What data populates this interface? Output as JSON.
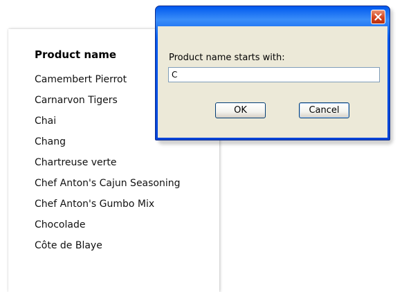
{
  "report": {
    "column_header": "Product name",
    "rows": [
      "Camembert Pierrot",
      "Carnarvon Tigers",
      "Chai",
      "Chang",
      "Chartreuse verte",
      "Chef Anton's Cajun Seasoning",
      "Chef Anton's Gumbo Mix",
      "Chocolade",
      "Côte de Blaye"
    ]
  },
  "dialog": {
    "title": "",
    "close_icon": "close-icon",
    "prompt": "Product name starts with:",
    "input_value": "C",
    "ok_label": "OK",
    "cancel_label": "Cancel"
  },
  "colors": {
    "titlebar": "#0058ee",
    "close_button": "#d4441e",
    "dialog_body": "#ece9d8"
  }
}
